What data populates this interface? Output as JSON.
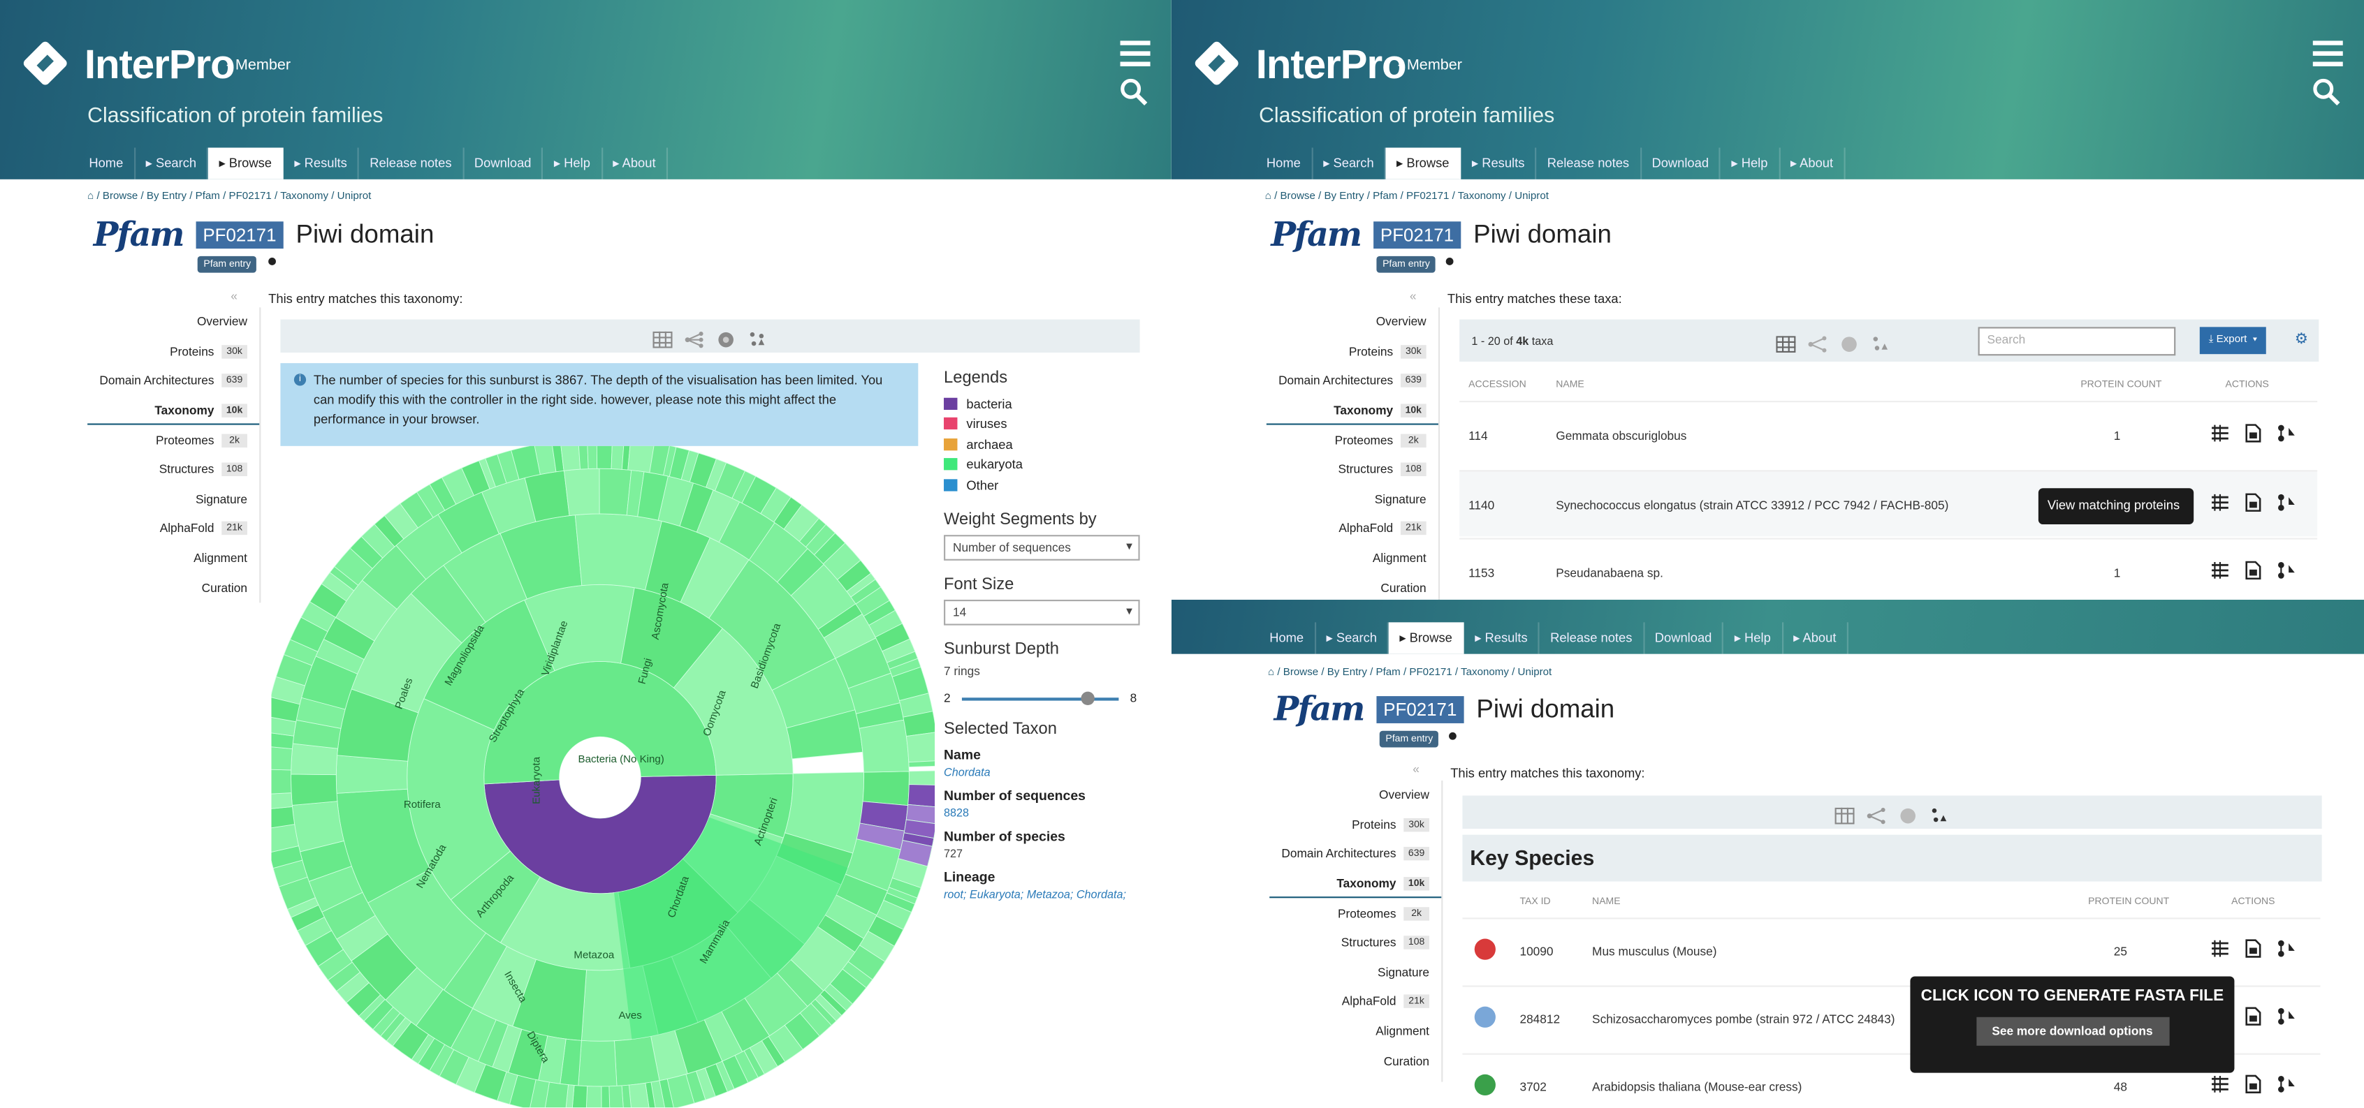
{
  "header": {
    "brand": "InterPro",
    "member": "- Member",
    "tagline": "Classification of protein families"
  },
  "nav": [
    {
      "label": "Home",
      "active": false
    },
    {
      "label": "▸ Search",
      "active": false
    },
    {
      "label": "▸ Browse",
      "active": true
    },
    {
      "label": "▸ Results",
      "active": false
    },
    {
      "label": "Release notes",
      "active": false
    },
    {
      "label": "Download",
      "active": false
    },
    {
      "label": "▸ Help",
      "active": false
    },
    {
      "label": "▸ About",
      "active": false
    }
  ],
  "breadcrumb": {
    "parts": [
      "Browse",
      "By Entry",
      "Pfam",
      "PF02171",
      "Taxonomy",
      "Uniprot"
    ]
  },
  "entry": {
    "db": "Pfam",
    "accession": "PF02171",
    "name": "Piwi domain",
    "type": "Pfam entry"
  },
  "sidebar": [
    {
      "label": "Overview",
      "badge": ""
    },
    {
      "label": "Proteins",
      "badge": "30k"
    },
    {
      "label": "Domain Architectures",
      "badge": "639"
    },
    {
      "label": "Taxonomy",
      "badge": "10k",
      "active": true
    },
    {
      "label": "Proteomes",
      "badge": "2k"
    },
    {
      "label": "Structures",
      "badge": "108"
    },
    {
      "label": "Signature",
      "badge": ""
    },
    {
      "label": "AlphaFold",
      "badge": "21k"
    },
    {
      "label": "Alignment",
      "badge": ""
    },
    {
      "label": "Curation",
      "badge": ""
    }
  ],
  "panel1": {
    "matches": "This entry matches this taxonomy:",
    "notice": "The number of species for this sunburst is 3867. The depth of the visualisation has been limited. You can modify this with the controller in the right side. however, please note this might affect the performance in your browser.",
    "legends_title": "Legends",
    "legends": [
      {
        "label": "bacteria",
        "color": "#6b3fa0"
      },
      {
        "label": "viruses",
        "color": "#e8436d"
      },
      {
        "label": "archaea",
        "color": "#e8a33a"
      },
      {
        "label": "eukaryota",
        "color": "#3fe87a"
      },
      {
        "label": "Other",
        "color": "#2a8fcf"
      }
    ],
    "weight_title": "Weight Segments by",
    "weight_value": "Number of sequences",
    "font_title": "Font Size",
    "font_value": "14",
    "depth_title": "Sunburst Depth",
    "depth_value": "7 rings",
    "depth_min": "2",
    "depth_max": "8",
    "depth_level": 0.82,
    "selected_title": "Selected Taxon",
    "name_label": "Name",
    "name_value": "Chordata",
    "nseq_label": "Number of sequences",
    "nseq_value": "8828",
    "nspec_label": "Number of species",
    "nspec_value": "727",
    "lineage_label": "Lineage",
    "lineage_value": "root; Eukaryota; Metazoa; Chordata;",
    "sunburst_labels": {
      "inner": [
        "Eukaryota",
        "Bacteria (No King)",
        "Metazoa",
        "Viridiplantae",
        "Fungi",
        "Chordata",
        "Arthropoda",
        "Ascomycota",
        "Streptophyta",
        "Magnoliopsida",
        "Nematoda",
        "Mammalia",
        "Aves",
        "Insecta",
        "Diptera",
        "Poales",
        "Rotifera",
        "Actinopteri",
        "Oomycota",
        "Basidiomycota"
      ]
    }
  },
  "panel2": {
    "matches": "This entry matches these taxa:",
    "range": "1 - 20 of ",
    "range_bold": "4k",
    "range_tail": " taxa",
    "search_placeholder": "Search",
    "export": "Export",
    "columns": [
      "ACCESSION",
      "NAME",
      "PROTEIN COUNT",
      "ACTIONS"
    ],
    "rows": [
      {
        "accession": "114",
        "name": "Gemmata obscuriglobus",
        "count": "1"
      },
      {
        "accession": "1140",
        "name": "Synechococcus elongatus (strain ATCC 33912 / PCC 7942 / FACHB-805)",
        "count": ""
      },
      {
        "accession": "1153",
        "name": "Pseudanabaena sp.",
        "count": "1"
      }
    ],
    "tooltip": "View matching proteins"
  },
  "panel3": {
    "matches": "This entry matches this taxonomy:",
    "key_species": "Key Species",
    "columns": [
      "TAX ID",
      "NAME",
      "PROTEIN COUNT",
      "ACTIONS"
    ],
    "rows": [
      {
        "taxid": "10090",
        "name": "Mus musculus (Mouse)",
        "count": "25"
      },
      {
        "taxid": "284812",
        "name": "Schizosaccharomyces pombe (strain 972 / ATCC 24843)",
        "count": ""
      },
      {
        "taxid": "3702",
        "name": "Arabidopsis thaliana (Mouse-ear cress)",
        "count": "48"
      }
    ],
    "popup_title": "CLICK ICON TO GENERATE FASTA FILE",
    "popup_button": "See more download options"
  }
}
